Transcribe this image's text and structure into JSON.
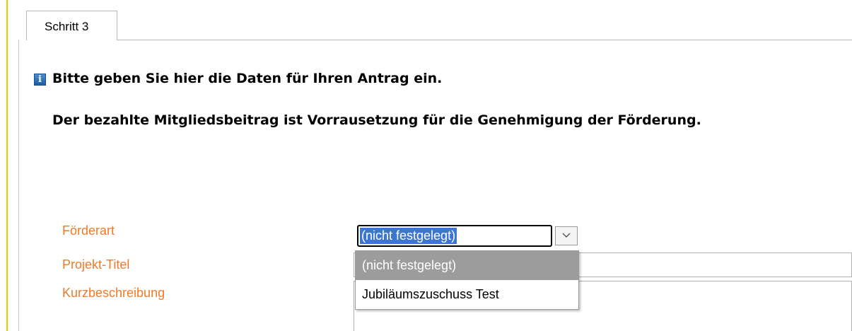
{
  "tab": {
    "label": "Schritt 3"
  },
  "info": {
    "heading": "Bitte geben Sie hier die Daten für Ihren Antrag ein.",
    "subheading": "Der bezahlte Mitgliedsbeitrag ist Vorrausetzung für die Genehmigung der Förderung."
  },
  "form": {
    "foerderart_label": "Förderart",
    "projekt_titel_label": "Projekt-Titel",
    "kurzbeschreibung_label": "Kurzbeschreibung",
    "foerderart_value": "(nicht festgelegt)",
    "projekt_titel_value": "",
    "kurzbeschreibung_value": "",
    "options": [
      "(nicht festgelegt)",
      "Jubiläumszuschuss Test"
    ]
  },
  "colors": {
    "accent": "#f2c500",
    "label": "#f07a25",
    "selection": "#3b76d6",
    "highlight": "#9c9c9c"
  },
  "icons": [
    "info-icon",
    "chevron-down-icon"
  ]
}
